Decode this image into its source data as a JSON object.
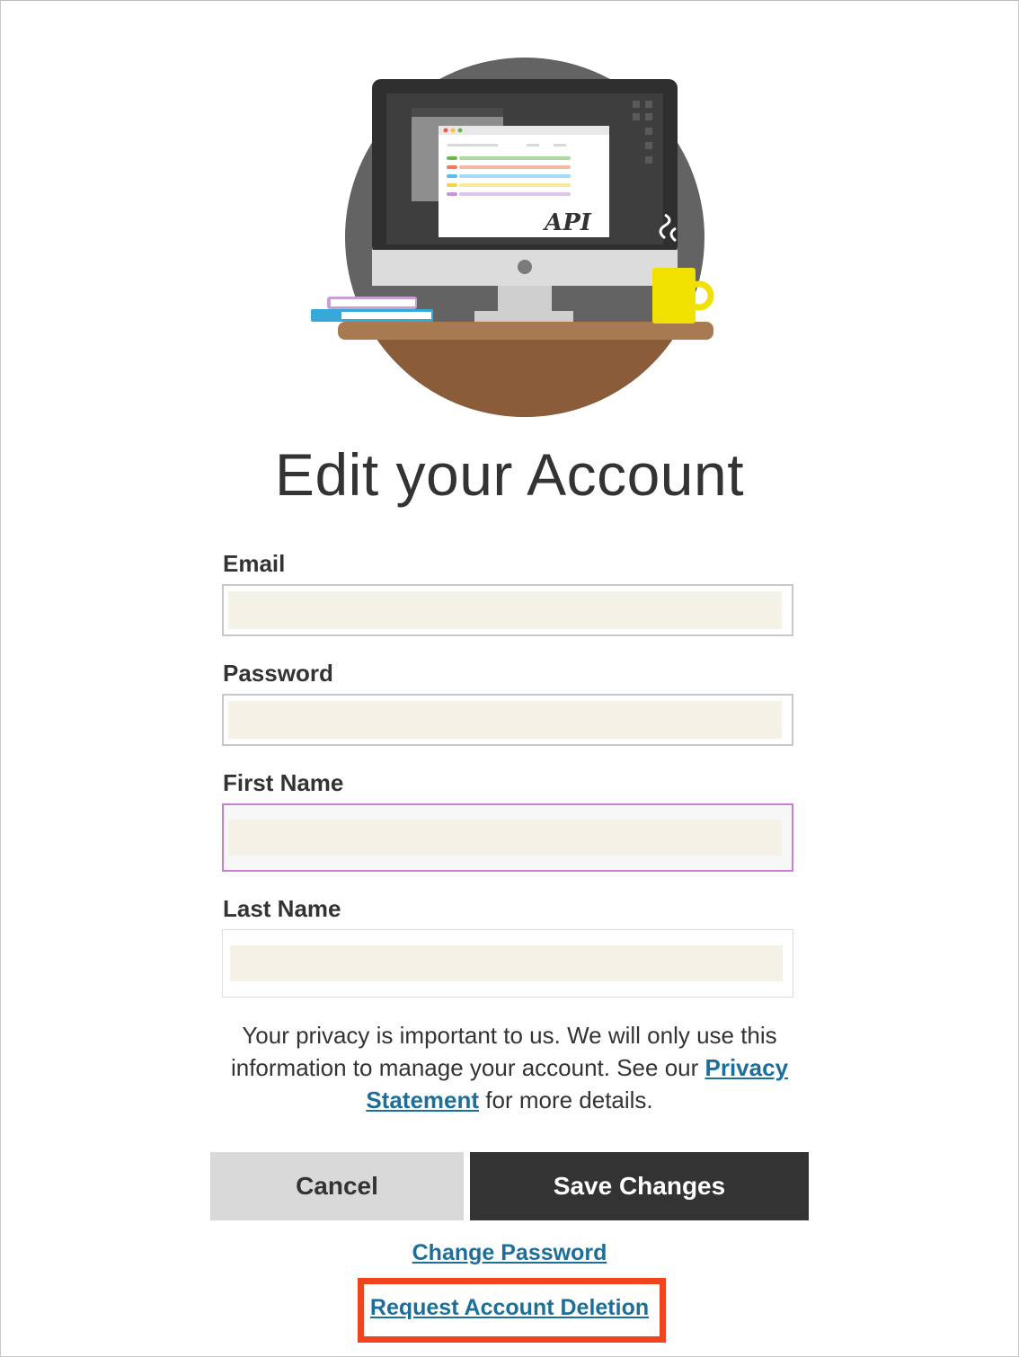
{
  "page": {
    "title": "Edit your Account"
  },
  "illustration": {
    "screen_text": "API",
    "line_colors": [
      "#6ab850",
      "#ef7b5b",
      "#56c0e8",
      "#f1d64b",
      "#c595d8"
    ]
  },
  "form": {
    "email": {
      "label": "Email",
      "value": "",
      "placeholder": ""
    },
    "password": {
      "label": "Password",
      "value": "",
      "placeholder": ""
    },
    "first_name": {
      "label": "First Name",
      "value": "",
      "placeholder": ""
    },
    "last_name": {
      "label": "Last Name",
      "value": "",
      "placeholder": ""
    }
  },
  "privacy": {
    "text_before": "Your privacy is important to us. We will only use this information to manage your account. See our ",
    "link_label": "Privacy Statement",
    "text_after": " for more details."
  },
  "actions": {
    "cancel_label": "Cancel",
    "save_label": "Save Changes",
    "change_password_label": "Change Password",
    "request_deletion_label": "Request Account Deletion"
  },
  "colors": {
    "link": "#1d6f99",
    "primary_button": "#333333",
    "secondary_button": "#d9d9d9",
    "focus_border": "#c77ed3",
    "highlight": "#f0441e",
    "input_fill": "#f4f2e7"
  }
}
